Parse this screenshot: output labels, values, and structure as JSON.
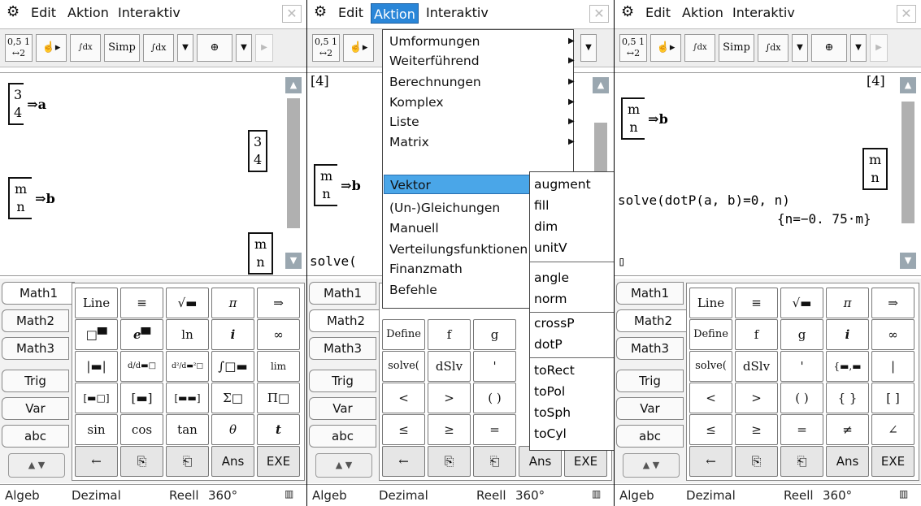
{
  "menubar": {
    "edit": "Edit",
    "aktion": "Aktion",
    "interaktiv": "Interaktiv",
    "close": "✕"
  },
  "toolbar": {
    "frac": "0,5 ½",
    "simp": "Simp",
    "defint": "∫dx",
    "graph": "⊕"
  },
  "screens": [
    {
      "work": {
        "m1": [
          "3",
          "4"
        ],
        "m1_assign": "⇒a",
        "m1_result": [
          "3",
          "4"
        ],
        "m2": [
          "m",
          "n"
        ],
        "m2_assign": "⇒b",
        "m2_result": [
          "m",
          "n"
        ]
      }
    },
    {
      "work": {
        "top_bracket": "[4]",
        "m2": [
          "m",
          "n"
        ],
        "m2_assign": "⇒b",
        "solve": "solve("
      }
    },
    {
      "work": {
        "top_bracket": "[4]",
        "m2": [
          "m",
          "n"
        ],
        "m2_assign": "⇒b",
        "m2_result": [
          "m",
          "n"
        ],
        "cmd": "solve(dotP(a, b)=0, n)",
        "result": "{n=−0. 75·m}",
        "cursor": "▯"
      }
    }
  ],
  "tabs": [
    "Math1",
    "Math2",
    "Math3",
    "Trig",
    "Var",
    "abc"
  ],
  "keyboard_math1": [
    [
      "Line",
      "≡",
      "√▬",
      "π",
      "⇒"
    ],
    [
      "□▀",
      "e▀",
      "ln",
      "i",
      "∞"
    ],
    [
      "|▬|",
      "d/d▬□",
      "d²/d▬²□",
      "∫□▬",
      "lim"
    ],
    [
      "[▬□]",
      "[▬]",
      "[▬▬]",
      "Σ□",
      "Π□"
    ],
    [
      "sin",
      "cos",
      "tan",
      "θ",
      "t"
    ],
    [
      "←",
      "⎘",
      "⎗",
      "Ans",
      "EXE"
    ]
  ],
  "keyboard_math2": [
    [
      "Define",
      "f",
      "g",
      "i",
      "∞"
    ],
    [
      "solve(",
      "dSlv",
      "'",
      "{▬,▬",
      "|"
    ],
    [
      "<",
      ">",
      "( )",
      "{ }",
      "[ ]"
    ],
    [
      "≤",
      "≥",
      "=",
      "≠",
      "∠"
    ],
    [
      "←",
      "⎘",
      "⎗",
      "Ans",
      "EXE"
    ]
  ],
  "menu_items": [
    "Umformungen",
    "Weiterführend",
    "Berechnungen",
    "Komplex",
    "Liste",
    "Matrix",
    "Vektor",
    "(Un-)Gleichungen",
    "Manuell",
    "Verteilungsfunktionen",
    "Finanzmath",
    "Befehle"
  ],
  "submenu_items": [
    "augment",
    "fill",
    "dim",
    "unitV",
    "angle",
    "norm",
    "crossP",
    "dotP",
    "toRect",
    "toPol",
    "toSph",
    "toCyl"
  ],
  "status": {
    "mode": "Algeb",
    "format": "Dezimal",
    "domain": "Reell",
    "angle": "360°"
  }
}
